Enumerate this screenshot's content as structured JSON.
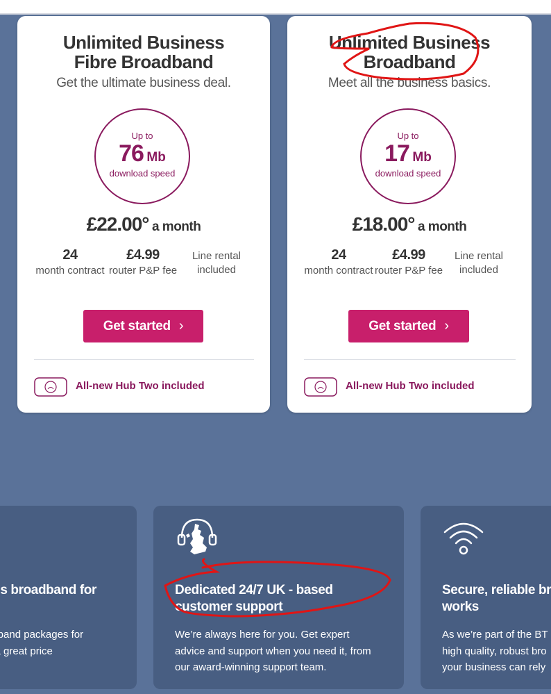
{
  "plans": [
    {
      "title": "Unlimited Business Fibre Broadband",
      "subtitle": "Get the ultimate business deal.",
      "speed_prefix": "Up to",
      "speed_value": "76",
      "speed_unit": "Mb",
      "speed_label": "download speed",
      "price": "£22.00°",
      "price_period": "a month",
      "features": [
        {
          "big": "24",
          "small": "month contract"
        },
        {
          "big": "£4.99",
          "small": "router P&P fee"
        },
        {
          "big": "",
          "small": "Line rental included"
        }
      ],
      "cta": "Get started",
      "cta_icon": "chevron-right-icon",
      "hub_text": "All-new Hub Two included"
    },
    {
      "title": "Unlimited Business Broadband",
      "subtitle": "Meet all the business basics.",
      "speed_prefix": "Up to",
      "speed_value": "17",
      "speed_unit": "Mb",
      "speed_label": "download speed",
      "price": "£18.00°",
      "price_period": "a month",
      "features": [
        {
          "big": "24",
          "small": "month contract"
        },
        {
          "big": "£4.99",
          "small": "router P&P fee"
        },
        {
          "big": "",
          "small": "Line rental included"
        }
      ],
      "cta": "Get started",
      "cta_icon": "chevron-right-icon",
      "hub_text": "All-new Hub Two included"
    }
  ],
  "benefits": [
    {
      "title": "ess broadband for",
      "body": [
        "adband packages for",
        "t a great price."
      ]
    },
    {
      "icon": "headset-uk-icon",
      "title": "Dedicated 24/7 UK - based customer support",
      "body": [
        "We’re always here for you. Get expert",
        "advice and support when you need it, from",
        "our award-winning support team."
      ]
    },
    {
      "icon": "wifi-icon",
      "title_lines": [
        "Secure, reliable broad",
        "works"
      ],
      "body": [
        "As we’re part of the BT",
        "high quality, robust bro",
        "your business can rely"
      ]
    }
  ],
  "colors": {
    "page_bg": "#5a7299",
    "accent": "#c81f6b",
    "brand_purple": "#8a1a5e",
    "panel_bg": "#485e82",
    "annotation_red": "#e01515"
  }
}
